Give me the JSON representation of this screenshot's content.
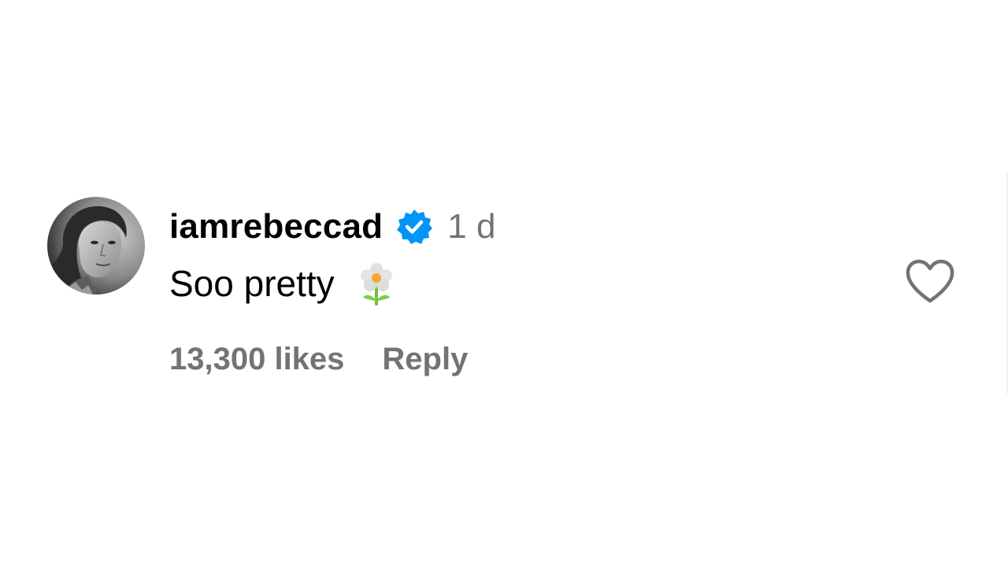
{
  "comment": {
    "username": "iamrebeccad",
    "verified": true,
    "time": "1 d",
    "text": "Soo pretty",
    "emoji": "flower-icon",
    "likes": "13,300 likes",
    "reply_label": "Reply"
  },
  "icons": {
    "avatar": "profile-photo",
    "verified": "verified-badge-icon",
    "like": "heart-icon"
  },
  "colors": {
    "verified_blue": "#0095f6",
    "secondary_text": "#737373",
    "primary_text": "#000000"
  }
}
